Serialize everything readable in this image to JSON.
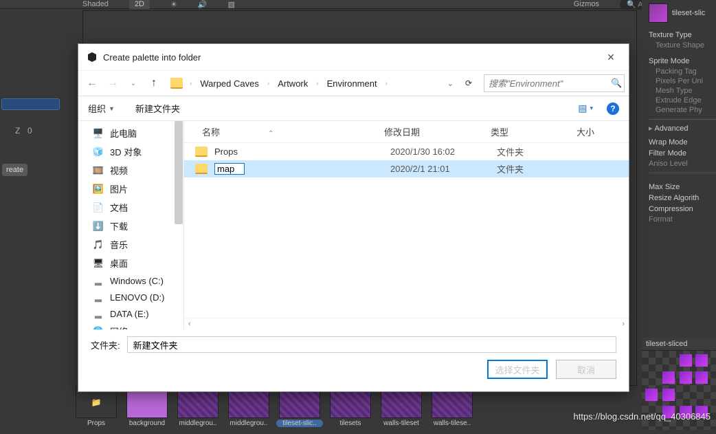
{
  "unity": {
    "top": {
      "shaded": "Shaded",
      "mode2d": "2D",
      "gizmos": "Gizmos",
      "search_prefix": "All"
    },
    "z_label": "Z",
    "z_value": "0",
    "create_btn": "reate",
    "assets": [
      {
        "name": "Props",
        "type": "folder"
      },
      {
        "name": "background",
        "type": "tex-light"
      },
      {
        "name": "middlegrou..",
        "type": "tex"
      },
      {
        "name": "middlegrou..",
        "type": "tex"
      },
      {
        "name": "tileset-slic..",
        "type": "tex",
        "selected": true
      },
      {
        "name": "tilesets",
        "type": "tex"
      },
      {
        "name": "walls-tileset",
        "type": "tex"
      },
      {
        "name": "walls-tilese..",
        "type": "tex"
      }
    ]
  },
  "inspector": {
    "title": "tileset-slic",
    "texture_type": "Texture Type",
    "texture_shape": "Texture Shape",
    "sprite_mode": "Sprite Mode",
    "sprite_items": [
      "Packing Tag",
      "Pixels Per Uni",
      "Mesh Type",
      "Extrude Edge",
      "Generate Phy"
    ],
    "advanced": "Advanced",
    "wrap_mode": "Wrap Mode",
    "filter_mode": "Filter Mode",
    "aniso": "Aniso Level",
    "max_size": "Max Size",
    "resize": "Resize Algorith",
    "compression": "Compression",
    "format": "Format",
    "preview_title": "tileset-sliced"
  },
  "dialog": {
    "title": "Create palette into folder",
    "breadcrumb": [
      "Warped Caves",
      "Artwork",
      "Environment"
    ],
    "search_placeholder": "搜索\"Environment\"",
    "toolbar": {
      "organize": "组织",
      "new_folder": "新建文件夹"
    },
    "sidebar": [
      {
        "label": "此电脑",
        "icon": "🖥️"
      },
      {
        "label": "3D 对象",
        "icon": "🧊"
      },
      {
        "label": "视频",
        "icon": "🎞️"
      },
      {
        "label": "图片",
        "icon": "🖼️"
      },
      {
        "label": "文档",
        "icon": "📄"
      },
      {
        "label": "下载",
        "icon": "⬇️"
      },
      {
        "label": "音乐",
        "icon": "🎵"
      },
      {
        "label": "桌面",
        "icon": "🖥"
      },
      {
        "label": "Windows (C:)",
        "icon": "drive"
      },
      {
        "label": "LENOVO (D:)",
        "icon": "drive"
      },
      {
        "label": "DATA (E:)",
        "icon": "drive"
      },
      {
        "label": "网络",
        "icon": "🌐"
      }
    ],
    "columns": {
      "name": "名称",
      "date": "修改日期",
      "type": "类型",
      "size": "大小"
    },
    "rows": [
      {
        "name": "Props",
        "date": "2020/1/30 16:02",
        "type": "文件夹",
        "editing": false
      },
      {
        "name": "map",
        "date": "2020/2/1 21:01",
        "type": "文件夹",
        "editing": true,
        "selected": true
      }
    ],
    "footer": {
      "folder_label": "文件夹:",
      "folder_value": "新建文件夹",
      "select": "选择文件夹",
      "cancel": "取消"
    }
  },
  "watermark": "https://blog.csdn.net/qq_40306845"
}
